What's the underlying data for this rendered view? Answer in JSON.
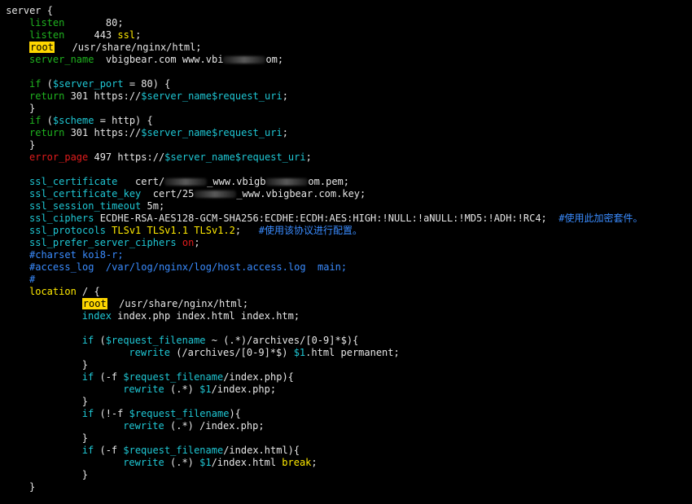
{
  "colors": {
    "default": "#e6e6e6",
    "green": "#1fb21f",
    "yellow": "#ffea00",
    "cyan": "#1fc7d4",
    "red": "#e21c1c",
    "blue": "#3a8cff",
    "root_highlight": "#ffd700"
  },
  "lines": [
    {
      "indent": 1,
      "tokens": [
        {
          "t": "server {",
          "c": "default"
        }
      ]
    },
    {
      "indent": 5,
      "tokens": [
        {
          "t": "listen",
          "c": "green"
        },
        {
          "t": "       80;",
          "c": "default"
        }
      ]
    },
    {
      "indent": 5,
      "tokens": [
        {
          "t": "listen",
          "c": "green"
        },
        {
          "t": "     443 ",
          "c": "default"
        },
        {
          "t": "ssl",
          "c": "yellow"
        },
        {
          "t": ";",
          "c": "default"
        }
      ]
    },
    {
      "indent": 5,
      "tokens": [
        {
          "t": "root",
          "c": "highlight"
        },
        {
          "t": "   /usr/share/nginx/html;",
          "c": "default"
        }
      ]
    },
    {
      "indent": 5,
      "tokens": [
        {
          "t": "server_name",
          "c": "green"
        },
        {
          "t": "  vbigbear.com www.vbi",
          "c": "default"
        },
        {
          "t": "",
          "c": "blur"
        },
        {
          "t": "om;",
          "c": "default"
        }
      ]
    },
    {
      "indent": 0,
      "tokens": []
    },
    {
      "indent": 5,
      "tokens": [
        {
          "t": "if",
          "c": "green"
        },
        {
          "t": " (",
          "c": "default"
        },
        {
          "t": "$server_port",
          "c": "cyan"
        },
        {
          "t": " = 80) {",
          "c": "default"
        }
      ]
    },
    {
      "indent": 5,
      "tokens": [
        {
          "t": "return",
          "c": "green"
        },
        {
          "t": " 301 https://",
          "c": "default"
        },
        {
          "t": "$server_name",
          "c": "cyan"
        },
        {
          "t": "$request_uri",
          "c": "cyan"
        },
        {
          "t": ";",
          "c": "default"
        }
      ]
    },
    {
      "indent": 5,
      "tokens": [
        {
          "t": "}",
          "c": "default"
        }
      ]
    },
    {
      "indent": 5,
      "tokens": [
        {
          "t": "if",
          "c": "green"
        },
        {
          "t": " (",
          "c": "default"
        },
        {
          "t": "$scheme",
          "c": "cyan"
        },
        {
          "t": " = http) {",
          "c": "default"
        }
      ]
    },
    {
      "indent": 5,
      "tokens": [
        {
          "t": "return",
          "c": "green"
        },
        {
          "t": " 301 https://",
          "c": "default"
        },
        {
          "t": "$server_name",
          "c": "cyan"
        },
        {
          "t": "$request_uri",
          "c": "cyan"
        },
        {
          "t": ";",
          "c": "default"
        }
      ]
    },
    {
      "indent": 5,
      "tokens": [
        {
          "t": "}",
          "c": "default"
        }
      ]
    },
    {
      "indent": 5,
      "tokens": [
        {
          "t": "error_page",
          "c": "red"
        },
        {
          "t": " 497 https://",
          "c": "default"
        },
        {
          "t": "$server_name",
          "c": "cyan"
        },
        {
          "t": "$request_uri",
          "c": "cyan"
        },
        {
          "t": ";",
          "c": "default"
        }
      ]
    },
    {
      "indent": 0,
      "tokens": []
    },
    {
      "indent": 5,
      "tokens": [
        {
          "t": "ssl_certificate",
          "c": "cyan"
        },
        {
          "t": "   cert/",
          "c": "default"
        },
        {
          "t": "",
          "c": "blur"
        },
        {
          "t": "_www.vbigb",
          "c": "default"
        },
        {
          "t": "",
          "c": "blur"
        },
        {
          "t": "om.pem;",
          "c": "default"
        }
      ]
    },
    {
      "indent": 5,
      "tokens": [
        {
          "t": "ssl_certificate_key",
          "c": "cyan"
        },
        {
          "t": "  cert/25",
          "c": "default"
        },
        {
          "t": "",
          "c": "blur"
        },
        {
          "t": "_www.vbigbear.com.key;",
          "c": "default"
        }
      ]
    },
    {
      "indent": 5,
      "tokens": [
        {
          "t": "ssl_session_timeout",
          "c": "cyan"
        },
        {
          "t": " 5m;",
          "c": "default"
        }
      ]
    },
    {
      "indent": 5,
      "tokens": [
        {
          "t": "ssl_ciphers",
          "c": "cyan"
        },
        {
          "t": " ECDHE-RSA-AES128-GCM-SHA256:ECDHE:ECDH:AES:HIGH:!NULL:!aNULL:!MD5:!ADH:!RC4;  ",
          "c": "default"
        },
        {
          "t": "#使用此加密套件。",
          "c": "blue"
        }
      ]
    },
    {
      "indent": 5,
      "tokens": [
        {
          "t": "ssl_protocols",
          "c": "cyan"
        },
        {
          "t": " ",
          "c": "default"
        },
        {
          "t": "TLSv1 TLSv1.1 TLSv1.2",
          "c": "yellow"
        },
        {
          "t": ";   ",
          "c": "default"
        },
        {
          "t": "#使用该协议进行配置。",
          "c": "blue"
        }
      ]
    },
    {
      "indent": 5,
      "tokens": [
        {
          "t": "ssl_prefer_server_ciphers",
          "c": "cyan"
        },
        {
          "t": " ",
          "c": "default"
        },
        {
          "t": "on",
          "c": "red"
        },
        {
          "t": ";",
          "c": "default"
        }
      ]
    },
    {
      "indent": 5,
      "tokens": [
        {
          "t": "#charset koi8-r;",
          "c": "blue"
        }
      ]
    },
    {
      "indent": 5,
      "tokens": [
        {
          "t": "#access_log  /var/log/nginx/log/host.access.log  main;",
          "c": "blue"
        }
      ]
    },
    {
      "indent": 5,
      "tokens": [
        {
          "t": "#",
          "c": "blue"
        }
      ]
    },
    {
      "indent": 5,
      "tokens": [
        {
          "t": "location",
          "c": "yellow"
        },
        {
          "t": " / {",
          "c": "default"
        }
      ]
    },
    {
      "indent": 14,
      "tokens": [
        {
          "t": "root",
          "c": "highlight"
        },
        {
          "t": "  /usr/share/nginx/html;",
          "c": "default"
        }
      ]
    },
    {
      "indent": 14,
      "tokens": [
        {
          "t": "index",
          "c": "cyan"
        },
        {
          "t": " index.php index.html index.htm;",
          "c": "default"
        }
      ]
    },
    {
      "indent": 0,
      "tokens": []
    },
    {
      "indent": 14,
      "tokens": [
        {
          "t": "if",
          "c": "cyan"
        },
        {
          "t": " (",
          "c": "default"
        },
        {
          "t": "$request_filename",
          "c": "cyan"
        },
        {
          "t": " ~ (.*)/archives/[0-9]*$){",
          "c": "default"
        }
      ]
    },
    {
      "indent": 22,
      "tokens": [
        {
          "t": "rewrite",
          "c": "cyan"
        },
        {
          "t": " (/archives/[0-9]*$) ",
          "c": "default"
        },
        {
          "t": "$1",
          "c": "cyan"
        },
        {
          "t": ".html permanent;",
          "c": "default"
        }
      ]
    },
    {
      "indent": 14,
      "tokens": [
        {
          "t": "}",
          "c": "default"
        }
      ]
    },
    {
      "indent": 14,
      "tokens": [
        {
          "t": "if",
          "c": "cyan"
        },
        {
          "t": " (-f ",
          "c": "default"
        },
        {
          "t": "$request_filename",
          "c": "cyan"
        },
        {
          "t": "/index.php){",
          "c": "default"
        }
      ]
    },
    {
      "indent": 21,
      "tokens": [
        {
          "t": "rewrite",
          "c": "cyan"
        },
        {
          "t": " (.*) ",
          "c": "default"
        },
        {
          "t": "$1",
          "c": "cyan"
        },
        {
          "t": "/index.php;",
          "c": "default"
        }
      ]
    },
    {
      "indent": 14,
      "tokens": [
        {
          "t": "}",
          "c": "default"
        }
      ]
    },
    {
      "indent": 14,
      "tokens": [
        {
          "t": "if",
          "c": "cyan"
        },
        {
          "t": " (!-f ",
          "c": "default"
        },
        {
          "t": "$request_filename",
          "c": "cyan"
        },
        {
          "t": "){",
          "c": "default"
        }
      ]
    },
    {
      "indent": 21,
      "tokens": [
        {
          "t": "rewrite",
          "c": "cyan"
        },
        {
          "t": " (.*) /index.php;",
          "c": "default"
        }
      ]
    },
    {
      "indent": 14,
      "tokens": [
        {
          "t": "}",
          "c": "default"
        }
      ]
    },
    {
      "indent": 14,
      "tokens": [
        {
          "t": "if",
          "c": "cyan"
        },
        {
          "t": " (-f ",
          "c": "default"
        },
        {
          "t": "$request_filename",
          "c": "cyan"
        },
        {
          "t": "/index.html){",
          "c": "default"
        }
      ]
    },
    {
      "indent": 21,
      "tokens": [
        {
          "t": "rewrite",
          "c": "cyan"
        },
        {
          "t": " (.*) ",
          "c": "default"
        },
        {
          "t": "$1",
          "c": "cyan"
        },
        {
          "t": "/index.html ",
          "c": "default"
        },
        {
          "t": "break",
          "c": "yellow"
        },
        {
          "t": ";",
          "c": "default"
        }
      ]
    },
    {
      "indent": 14,
      "tokens": [
        {
          "t": "}",
          "c": "default"
        }
      ]
    },
    {
      "indent": 5,
      "tokens": [
        {
          "t": "}",
          "c": "default"
        }
      ]
    }
  ]
}
